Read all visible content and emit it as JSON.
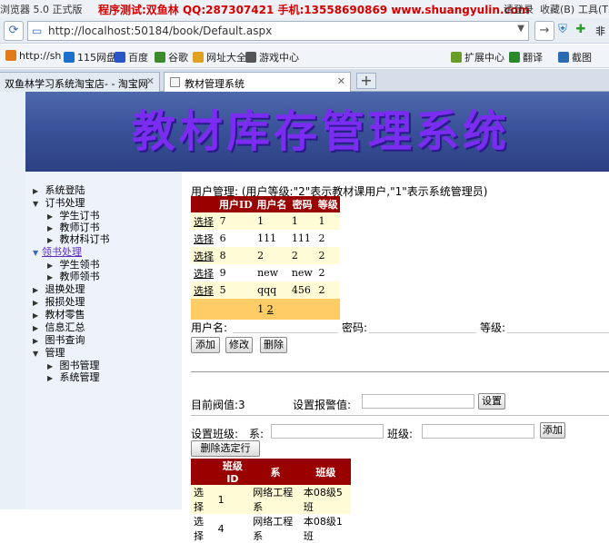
{
  "browser": {
    "app_name": "浏览器 5.0 正式版",
    "banner": "程序测试:双鱼林 QQ:287307421 手机:13558690869 www.shuangyulin.com",
    "menu": {
      "login": "请登录",
      "favorites": "收藏(B)",
      "tools": "工具(T)"
    },
    "address": "http://localhost:50184/book/Default.aspx",
    "right_cut": "非"
  },
  "favorites": {
    "items": [
      {
        "label": "http://sh",
        "icon": "globe-icon",
        "color": "#e07b1a"
      },
      {
        "label": "115网盘",
        "icon": "cloud-icon",
        "color": "#1c6fcc"
      },
      {
        "label": "百度",
        "icon": "baidu-icon",
        "color": "#2a56c6"
      },
      {
        "label": "谷歌",
        "icon": "google-icon",
        "color": "#3c8c2c"
      },
      {
        "label": "网址大全",
        "icon": "sites-icon",
        "color": "#e0a020"
      },
      {
        "label": "游戏中心",
        "icon": "game-icon",
        "color": "#555555"
      }
    ],
    "right": [
      {
        "label": "扩展中心",
        "icon": "extension-icon",
        "color": "#6a9c2a"
      },
      {
        "label": "翻译",
        "icon": "translate-icon",
        "color": "#2a8a2a"
      },
      {
        "label": "截图",
        "icon": "screenshot-icon",
        "color": "#2a6ab0"
      }
    ]
  },
  "tabs": [
    {
      "label": "双鱼林学习系统淘宝店- - 淘宝网",
      "active": false
    },
    {
      "label": "教材管理系统",
      "active": true
    }
  ],
  "header": {
    "title": "教材库存管理系统"
  },
  "sidebar": {
    "items": [
      {
        "label": "系统登陆",
        "level": 0,
        "arrow": "▶"
      },
      {
        "label": "订书处理",
        "level": 0,
        "arrow": "▼"
      },
      {
        "label": "学生订书",
        "level": 1,
        "arrow": "▶"
      },
      {
        "label": "教师订书",
        "level": 1,
        "arrow": "▶"
      },
      {
        "label": "教材科订书",
        "level": 1,
        "arrow": "▶"
      },
      {
        "label": "领书处理",
        "level": 0,
        "arrow": "▼",
        "link": true
      },
      {
        "label": "学生领书",
        "level": 1,
        "arrow": "▶"
      },
      {
        "label": "教师领书",
        "level": 1,
        "arrow": "▶"
      },
      {
        "label": "退换处理",
        "level": 0,
        "arrow": "▶"
      },
      {
        "label": "报损处理",
        "level": 0,
        "arrow": "▶"
      },
      {
        "label": "教材零售",
        "level": 0,
        "arrow": "▶"
      },
      {
        "label": "信息汇总",
        "level": 0,
        "arrow": "▶"
      },
      {
        "label": "图书查询",
        "level": 0,
        "arrow": "▶"
      },
      {
        "label": "管理",
        "level": 0,
        "arrow": "▼"
      },
      {
        "label": "图书管理",
        "level": 1,
        "arrow": "▶"
      },
      {
        "label": "系统管理",
        "level": 1,
        "arrow": "▶"
      }
    ]
  },
  "user_mgmt": {
    "heading": "用户管理: (用户等级:\"2\"表示教材课用户,\"1\"表示系统管理员)",
    "columns": [
      "",
      "用户ID",
      "用户名",
      "密码",
      "等级"
    ],
    "rows": [
      {
        "select": "选择",
        "id": "7",
        "name": "1",
        "password": "1",
        "level": "1"
      },
      {
        "select": "选择",
        "id": "6",
        "name": "111",
        "password": "111",
        "level": "2"
      },
      {
        "select": "选择",
        "id": "8",
        "name": "2",
        "password": "2",
        "level": "2"
      },
      {
        "select": "选择",
        "id": "9",
        "name": "new",
        "password": "new",
        "level": "2"
      },
      {
        "select": "选择",
        "id": "5",
        "name": "qqq",
        "password": "456",
        "level": "2"
      }
    ],
    "pager": {
      "current": "1",
      "next": "2"
    },
    "form": {
      "username_label": "用户名:",
      "password_label": "密码:",
      "level_label": "等级:",
      "username_value": "",
      "password_value": "",
      "level_value": "",
      "add": "添加",
      "edit": "修改",
      "delete": "删除"
    }
  },
  "threshold": {
    "current_label": "目前阀值:3",
    "set_label": "设置报警值:",
    "set_value": "",
    "set_button": "设置"
  },
  "class_setup": {
    "label": "设置班级:",
    "dept_label": "系:",
    "dept_value": "",
    "class_label": "班级:",
    "class_value": "",
    "add": "添加",
    "delete_selected": "删除选定行",
    "columns": [
      "",
      "班级ID",
      "系",
      "班级"
    ],
    "rows": [
      {
        "select": "选择",
        "id": "1",
        "dept": "网络工程系",
        "class": "本08级5班"
      },
      {
        "select": "选择",
        "id": "4",
        "dept": "网络工程系",
        "class": "本08级1班"
      }
    ]
  }
}
